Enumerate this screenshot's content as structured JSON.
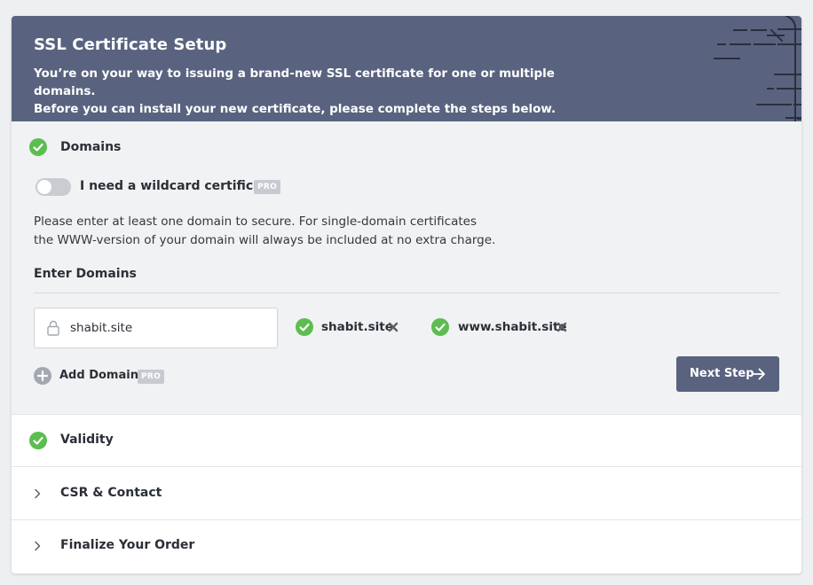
{
  "header": {
    "title": "SSL Certificate Setup",
    "subtitle_line1": "You’re on your way to issuing a brand-new SSL certificate for one or multiple domains.",
    "subtitle_line2": "Before you can install your new certificate, please complete the steps below.",
    "bg_color": "#59637f"
  },
  "domains_section": {
    "title": "Domains",
    "status_icon": "check-circle-icon",
    "wildcard": {
      "label": "I need a wildcard certificate",
      "badge": "PRO",
      "enabled": false
    },
    "description_line1": "Please enter at least one domain to secure. For single-domain certificates",
    "description_line2": "the WWW-version of your domain will always be included at no extra charge.",
    "enter_label": "Enter Domains",
    "input": {
      "value": "shabit.site",
      "placeholder": ""
    },
    "added_domains": [
      {
        "name": "shabit.site",
        "icon": "check-circle-icon",
        "remove_icon": "close-icon"
      },
      {
        "name": "www.shabit.site",
        "icon": "check-circle-icon",
        "remove_icon": "close-icon"
      }
    ],
    "add_domain": {
      "label": "Add Domain",
      "badge": "PRO",
      "icon": "plus-circle-icon"
    },
    "next_button": {
      "label": "Next Step",
      "icon": "arrow-right-icon"
    }
  },
  "steps": [
    {
      "title": "Validity",
      "state": "completed",
      "icon": "check-circle-icon"
    },
    {
      "title": "CSR & Contact",
      "state": "collapsed",
      "icon": "chevron-right-icon"
    },
    {
      "title": "Finalize Your Order",
      "state": "collapsed",
      "icon": "chevron-right-icon"
    }
  ],
  "colors": {
    "accent": "#59637f",
    "success": "#5cbd50",
    "pro_badge": "#c7cad0"
  }
}
